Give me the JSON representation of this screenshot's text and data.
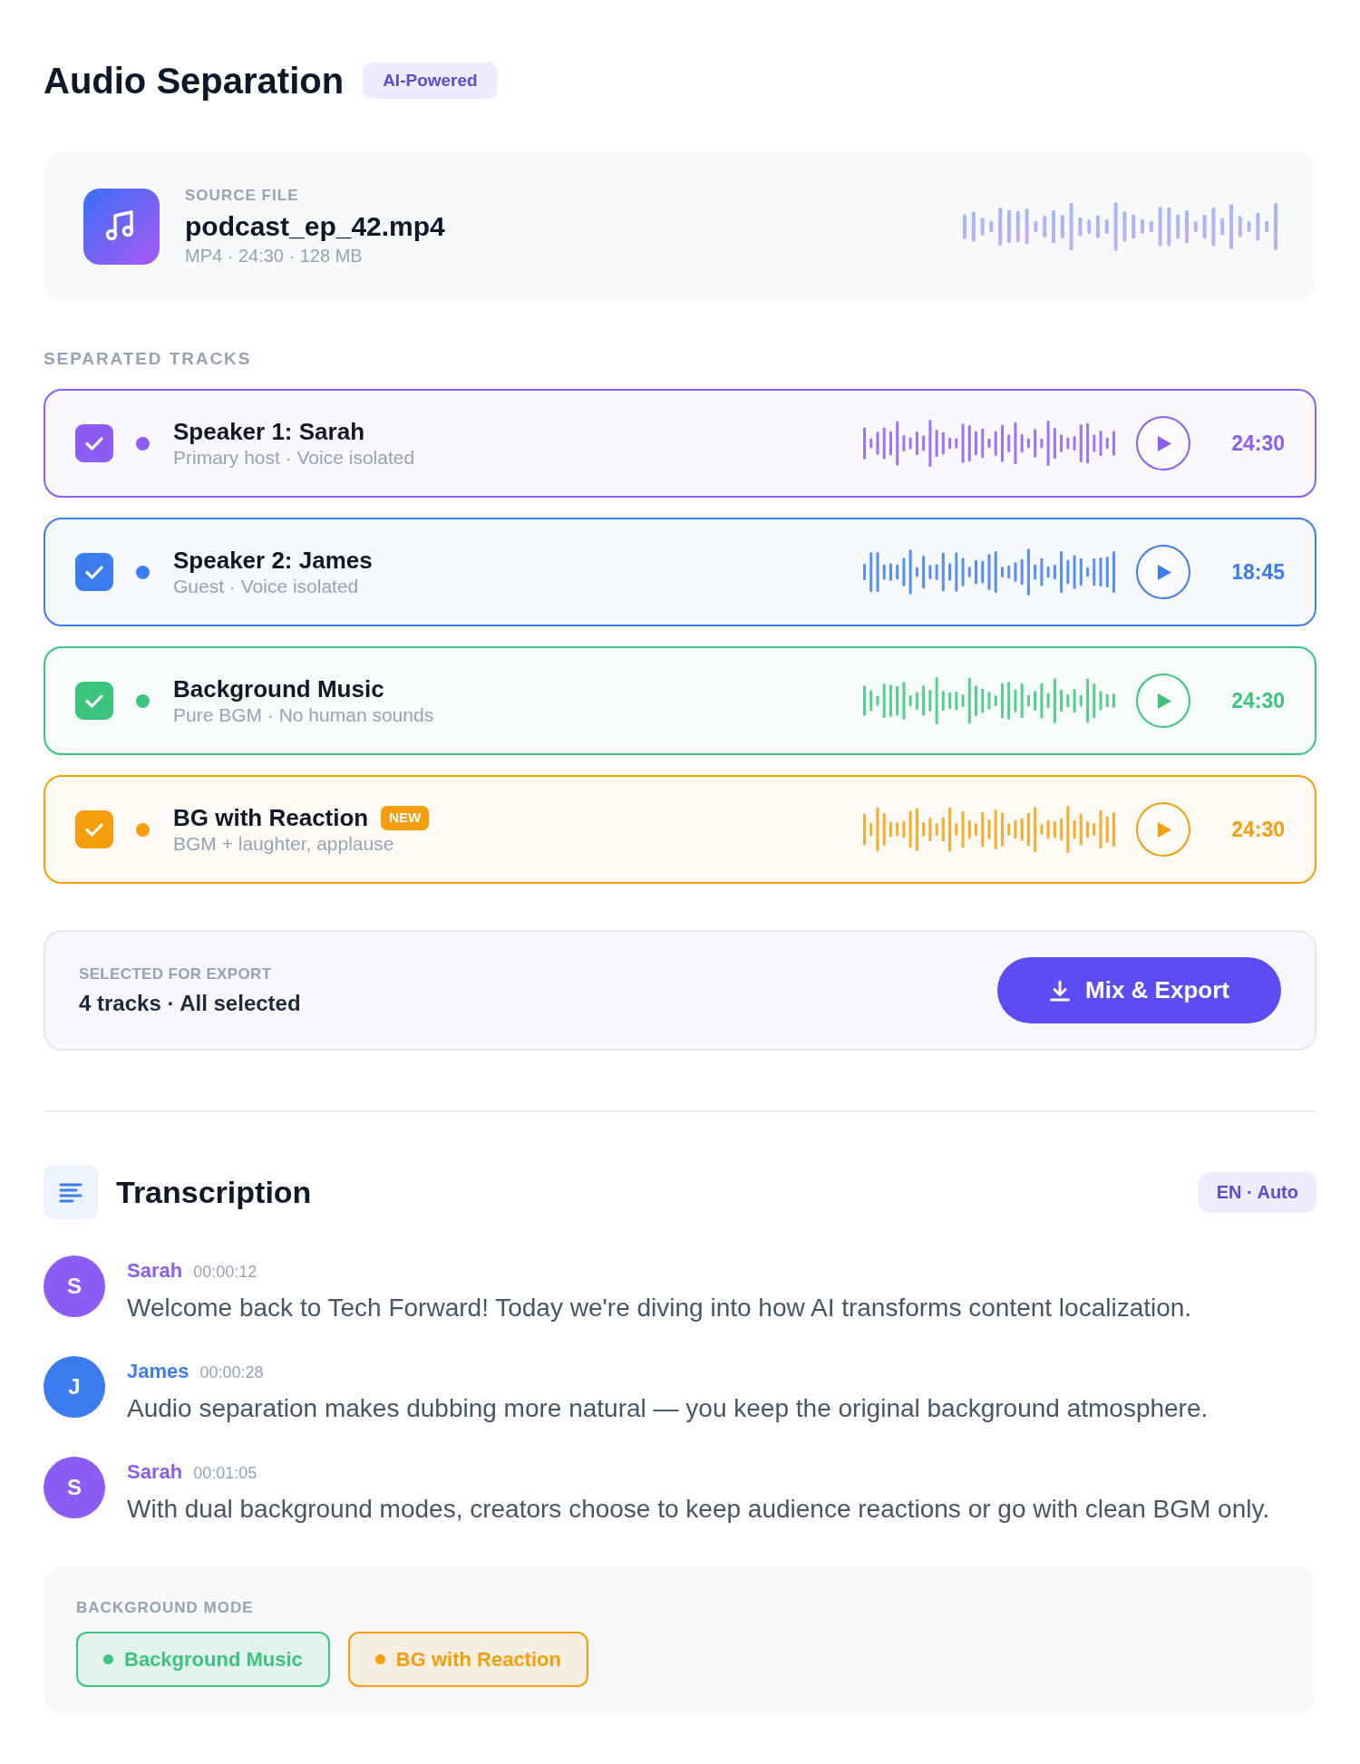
{
  "header": {
    "title": "Audio Separation",
    "badge": "AI-Powered"
  },
  "source_file": {
    "label": "SOURCE FILE",
    "name": "podcast_ep_42.mp4",
    "meta": "MP4 · 24:30 · 128 MB"
  },
  "tracks_section": {
    "label": "SEPARATED TRACKS"
  },
  "tracks": [
    {
      "name": "Speaker 1: Sarah",
      "subtitle": "Primary host · Voice isolated",
      "duration": "24:30",
      "checked": true,
      "color": "#8b5cf6"
    },
    {
      "name": "Speaker 2: James",
      "subtitle": "Guest · Voice isolated",
      "duration": "18:45",
      "checked": true,
      "color": "#3b7cf0"
    },
    {
      "name": "Background Music",
      "subtitle": "Pure BGM · No human sounds",
      "duration": "24:30",
      "checked": true,
      "color": "#3cc47f"
    },
    {
      "name": "BG with Reaction",
      "badge": "NEW",
      "subtitle": "BGM + laughter, applause",
      "duration": "24:30",
      "checked": true,
      "color": "#f59e0b"
    }
  ],
  "export": {
    "label": "SELECTED FOR EXPORT",
    "summary": "4 tracks · All selected",
    "button": "Mix & Export"
  },
  "transcription": {
    "title": "Transcription",
    "language": "EN · Auto",
    "entries": [
      {
        "initial": "S",
        "speaker": "Sarah",
        "time": "00:00:12",
        "text": "Welcome back to Tech Forward! Today we're diving into how AI transforms content localization.",
        "color": "#8b5cf6"
      },
      {
        "initial": "J",
        "speaker": "James",
        "time": "00:00:28",
        "text": "Audio separation makes dubbing more natural — you keep the original background atmosphere.",
        "color": "#3b7cf0"
      },
      {
        "initial": "S",
        "speaker": "Sarah",
        "time": "00:01:05",
        "text": "With dual background modes, creators choose to keep audience reactions or go with clean BGM only.",
        "color": "#8b5cf6"
      }
    ]
  },
  "background_mode": {
    "label": "BACKGROUND MODE",
    "options": [
      {
        "label": "Background Music",
        "color": "#3cc47f"
      },
      {
        "label": "BG with Reaction",
        "color": "#f59e0b"
      }
    ]
  }
}
